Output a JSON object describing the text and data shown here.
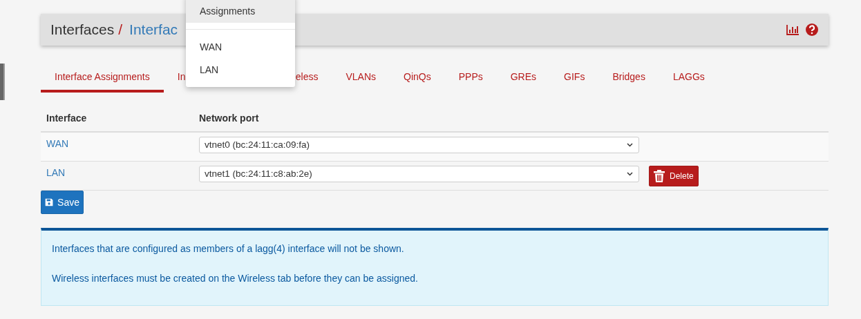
{
  "breadcrumb": [
    {
      "label": "Interfaces",
      "kind": "plain"
    },
    {
      "label": "/",
      "kind": "separator"
    },
    {
      "label": "Interfac",
      "kind": "link"
    }
  ],
  "header_icons": [
    {
      "kind": "chart"
    },
    {
      "kind": "help"
    }
  ],
  "menu": {
    "items": [
      {
        "label": "Assignments",
        "hovered": true,
        "kind": "item"
      },
      {
        "kind": "divider"
      },
      {
        "label": "WAN",
        "hovered": false,
        "kind": "item"
      },
      {
        "label": "LAN",
        "hovered": false,
        "kind": "item"
      }
    ]
  },
  "tabs": [
    {
      "label": "Interface Assignments",
      "selected": true
    },
    {
      "label": "In",
      "selected": false
    },
    {
      "label": "eless",
      "selected": false
    },
    {
      "label": "VLANs",
      "selected": false
    },
    {
      "label": "QinQs",
      "selected": false
    },
    {
      "label": "PPPs",
      "selected": false
    },
    {
      "label": "GREs",
      "selected": false
    },
    {
      "label": "GIFs",
      "selected": false
    },
    {
      "label": "Bridges",
      "selected": false
    },
    {
      "label": "LAGGs",
      "selected": false
    }
  ],
  "table": {
    "columns": [
      "Interface",
      "Network port"
    ],
    "rows": [
      {
        "interface": "WAN",
        "port": "vtnet0 (bc:24:11:ca:09:fa)",
        "deletable": false
      },
      {
        "interface": "LAN",
        "port": "vtnet1 (bc:24:11:c8:ab:2e)",
        "deletable": true,
        "delete_label": "Delete"
      }
    ]
  },
  "save_button": "Save",
  "notices": [
    "Interfaces that are configured as members of a lagg(4) interface will not be shown.",
    "Wireless interfaces must be created on the Wireless tab before they can be assigned."
  ]
}
